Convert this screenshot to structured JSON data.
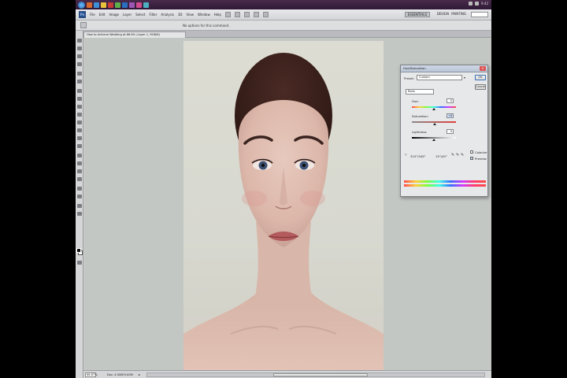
{
  "colors": {
    "taskbar": "#3a2340",
    "chrome": "#d8dadc",
    "canvas_bg": "#c3c7c4",
    "dialog_bg": "#e6e8ea"
  },
  "menu": {
    "logo": "Ps",
    "items": [
      "File",
      "Edit",
      "Image",
      "Layer",
      "Select",
      "Filter",
      "Analysis",
      "3D",
      "View",
      "Window",
      "Help"
    ],
    "workspace": "ESSENTIALS",
    "ws2": "DESIGN",
    "ws3": "PAINTING"
  },
  "options_bar": {
    "text": "No options for this command."
  },
  "document": {
    "tab_title": "How to Achieve Wedding at 66.6% (Layer 1, RGB/8)",
    "zoom": "66.67%",
    "info": "Doc: 4.50M/9.00M"
  },
  "hue_saturation": {
    "title": "Hue/Saturation",
    "preset_label": "Preset:",
    "preset_value": "Custom",
    "channel_value": "Reds",
    "hue_label": "Hue:",
    "hue_value": "0",
    "saturation_label": "Saturation:",
    "saturation_value": "+8",
    "lightness_label": "Lightness:",
    "lightness_value": "0",
    "range_left": "315°/345°",
    "range_right": "15°\\45°",
    "ok_label": "OK",
    "cancel_label": "Cancel",
    "colorize_label": "Colorize",
    "preview_label": "Preview",
    "hue_level": 0.5,
    "saturation_level": 0.52,
    "lightness_level": 0.5
  },
  "taskbar": {
    "clock": "9:42"
  }
}
